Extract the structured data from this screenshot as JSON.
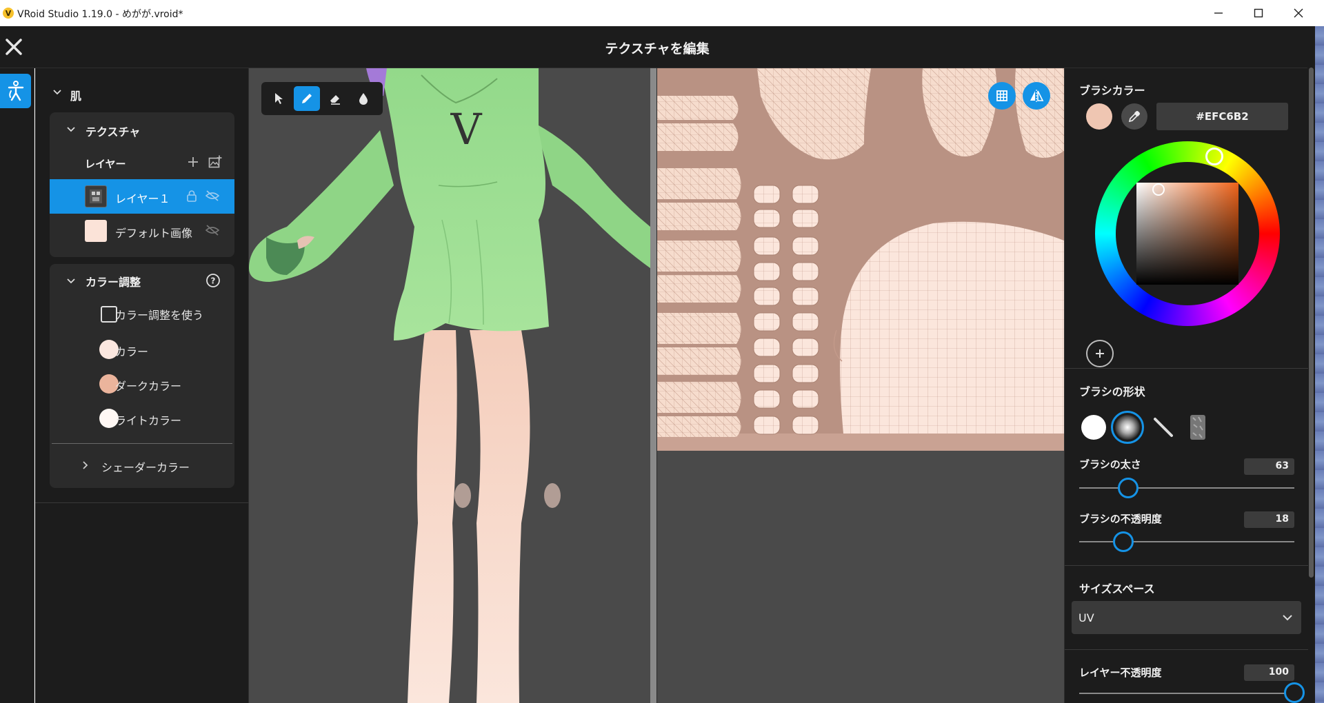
{
  "window": {
    "title": "VRoid Studio 1.19.0 - めがが.vroid*",
    "app_icon": "V"
  },
  "header": {
    "title": "テクスチャを編集"
  },
  "left": {
    "section": "肌",
    "texture": {
      "title": "テクスチャ",
      "layers_label": "レイヤー",
      "layers": [
        {
          "name": "レイヤー１",
          "selected": true
        },
        {
          "name": "デフォルト画像",
          "selected": false
        }
      ]
    },
    "color_adjust": {
      "title": "カラー調整",
      "use_label": "カラー調整を使う",
      "use_checked": false,
      "colors": [
        {
          "label": "カラー",
          "hex": "#FBE7DF"
        },
        {
          "label": "ダークカラー",
          "hex": "#EBB49C"
        },
        {
          "label": "ライトカラー",
          "hex": "#FFF8F4"
        }
      ],
      "shader_label": "シェーダーカラー"
    }
  },
  "right": {
    "brush_color": {
      "title": "ブラシカラー",
      "hex": "#EFC6B2"
    },
    "brush_shape": {
      "title": "ブラシの形状",
      "selected_index": 1
    },
    "brush_size": {
      "label": "ブラシの太さ",
      "value": "63",
      "fraction": 0.24
    },
    "brush_opacity": {
      "label": "ブラシの不透明度",
      "value": "18",
      "fraction": 0.21
    },
    "size_space": {
      "title": "サイズスペース",
      "value": "UV"
    },
    "layer_opacity": {
      "label": "レイヤー不透明度",
      "value": "100",
      "fraction": 1.0
    }
  },
  "colors": {
    "accent": "#1593E6",
    "panel": "#1C1C1C",
    "card": "#2B2B2B",
    "viewport": "#4A4A4A"
  }
}
